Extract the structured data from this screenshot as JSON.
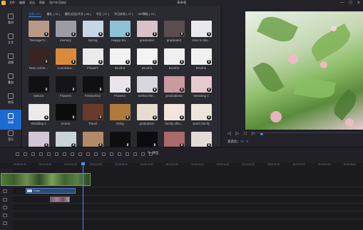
{
  "window": {
    "title": "未命名",
    "menus": [
      "文件",
      "编辑",
      "导出",
      "帮助",
      "用户许可协议"
    ],
    "controls": [
      "—",
      "☐",
      "✕"
    ]
  },
  "sidebar": {
    "items": [
      {
        "label": "素材",
        "active": false
      },
      {
        "label": "文字",
        "active": false
      },
      {
        "label": "滤镜",
        "active": false
      },
      {
        "label": "叠加",
        "active": false
      },
      {
        "label": "转场",
        "active": false
      },
      {
        "label": "动画",
        "active": true
      },
      {
        "label": "音乐",
        "active": false
      }
    ]
  },
  "library": {
    "tabs": [
      {
        "label": "全部 ( 87 )",
        "active": true
      },
      {
        "label": "婚礼 ( 19 )"
      },
      {
        "label": "婚礼/纪念/片头 ( 20 )"
      },
      {
        "label": "节日 ( 27 )"
      },
      {
        "label": "节日庆祝 ( 27 )"
      },
      {
        "label": "VIP模板 ( 22 )"
      }
    ],
    "rows": [
      [
        {
          "label": "Teenager's...",
          "icon": "thumbnail-photo-icon",
          "color": "#b89a86"
        },
        {
          "label": "memory",
          "icon": "thumbnail-photo-icon",
          "color": "#9a9ea4"
        },
        {
          "label": "Spring",
          "icon": "thumbnail-photo-icon",
          "color": "#c6d6e6"
        },
        {
          "label": "Happy Ea...",
          "icon": "thumbnail-photo-icon",
          "color": "#8fc1d6"
        },
        {
          "label": "graduate4",
          "icon": "thumbnail-photo-icon",
          "color": "#d9c1c8"
        },
        {
          "label": "graduate3",
          "icon": "thumbnail-photo-icon",
          "color": "#5a4e52"
        },
        {
          "label": "How to sta...",
          "icon": "thumbnail-photo-icon",
          "color": "#e8e8ee"
        }
      ],
      [
        {
          "label": "New comm...",
          "icon": "thumbnail-photo-icon",
          "color": "#3a2420"
        },
        {
          "label": "Countdow...",
          "icon": "thumbnail-photo-icon",
          "color": "#d98a3a"
        },
        {
          "label": "Flower7",
          "icon": "thumbnail-photo-icon",
          "color": "#eaeaea"
        },
        {
          "label": "Brush4",
          "icon": "thumbnail-photo-icon",
          "color": "#f2f2f2"
        },
        {
          "label": "Brush3",
          "icon": "thumbnail-photo-icon",
          "color": "#f4f4f4"
        },
        {
          "label": "Brush2",
          "icon": "thumbnail-photo-icon",
          "color": "#efefef"
        },
        {
          "label": "Brush1",
          "icon": "thumbnail-photo-icon",
          "color": "#f1f1f1"
        }
      ],
      [
        {
          "label": "Sakura",
          "icon": "thumbnail-photo-icon",
          "color": "#111114"
        },
        {
          "label": "Flower5",
          "icon": "thumbnail-photo-icon",
          "color": "#151517"
        },
        {
          "label": "Fireworks2",
          "icon": "thumbnail-photo-icon",
          "color": "#101014"
        },
        {
          "label": "Flower2",
          "icon": "thumbnail-photo-icon",
          "color": "#e9e4ea"
        },
        {
          "label": "Defeat the...",
          "icon": "thumbnail-photo-icon",
          "color": "#d6d6dc"
        },
        {
          "label": "graduation2",
          "icon": "thumbnail-photo-icon",
          "color": "#c99aa0"
        },
        {
          "label": "Wedding 2",
          "icon": "thumbnail-photo-icon",
          "color": "#e6c9cf"
        }
      ],
      [
        {
          "label": "Wedding 1",
          "icon": "thumbnail-photo-icon",
          "color": "#ece9ea"
        },
        {
          "label": "Scene",
          "icon": "thumbnail-photo-icon",
          "color": "#0c0c0e"
        },
        {
          "label": "Travel",
          "icon": "thumbnail-photo-icon",
          "color": "#6a3a2a"
        },
        {
          "label": "Viting",
          "icon": "thumbnail-photo-icon",
          "color": "#b07a3a"
        },
        {
          "label": "graduation",
          "icon": "thumbnail-photo-icon",
          "color": "#e6dccf"
        },
        {
          "label": "family albu...",
          "icon": "thumbnail-photo-icon",
          "color": "#f0e6dc"
        },
        {
          "label": "warm family",
          "icon": "thumbnail-photo-icon",
          "color": "#ece6da"
        }
      ],
      [
        {
          "label": "",
          "icon": "thumbnail-photo-icon",
          "color": "#d0c6d4"
        },
        {
          "label": "",
          "icon": "thumbnail-photo-icon",
          "color": "#c9d3da"
        },
        {
          "label": "",
          "icon": "thumbnail-photo-icon",
          "color": "#b08a6a"
        },
        {
          "label": "",
          "icon": "thumbnail-photo-icon",
          "color": "#0e0e10"
        },
        {
          "label": "",
          "icon": "thumbnail-photo-icon",
          "color": "#0c0c10"
        },
        {
          "label": "",
          "icon": "thumbnail-photo-icon",
          "color": "#a86a6a"
        },
        {
          "label": "",
          "icon": "thumbnail-photo-icon",
          "color": "#e2dcd6"
        }
      ]
    ]
  },
  "preview": {
    "controls": [
      "◁",
      "▷",
      "□",
      "▷"
    ],
    "ratio_label": "宽高比：",
    "ratio_value": "16 : 9"
  },
  "toolbar": {
    "export_label": "导出"
  },
  "timeline": {
    "ruler": [
      "00:00:00.00",
      "00:00:02.00",
      "00:00:04.00",
      "00:00:06.00",
      "00:00:08.00",
      "00:00:10.00",
      "00:00:12.00",
      "00:00:14.00",
      "00:00:16.00",
      "00:00:18.00",
      "00:00:20.00",
      "00:00:22.00",
      "00:00:24.00",
      "00:00:26.00"
    ],
    "text_clip_label": "Crop"
  }
}
